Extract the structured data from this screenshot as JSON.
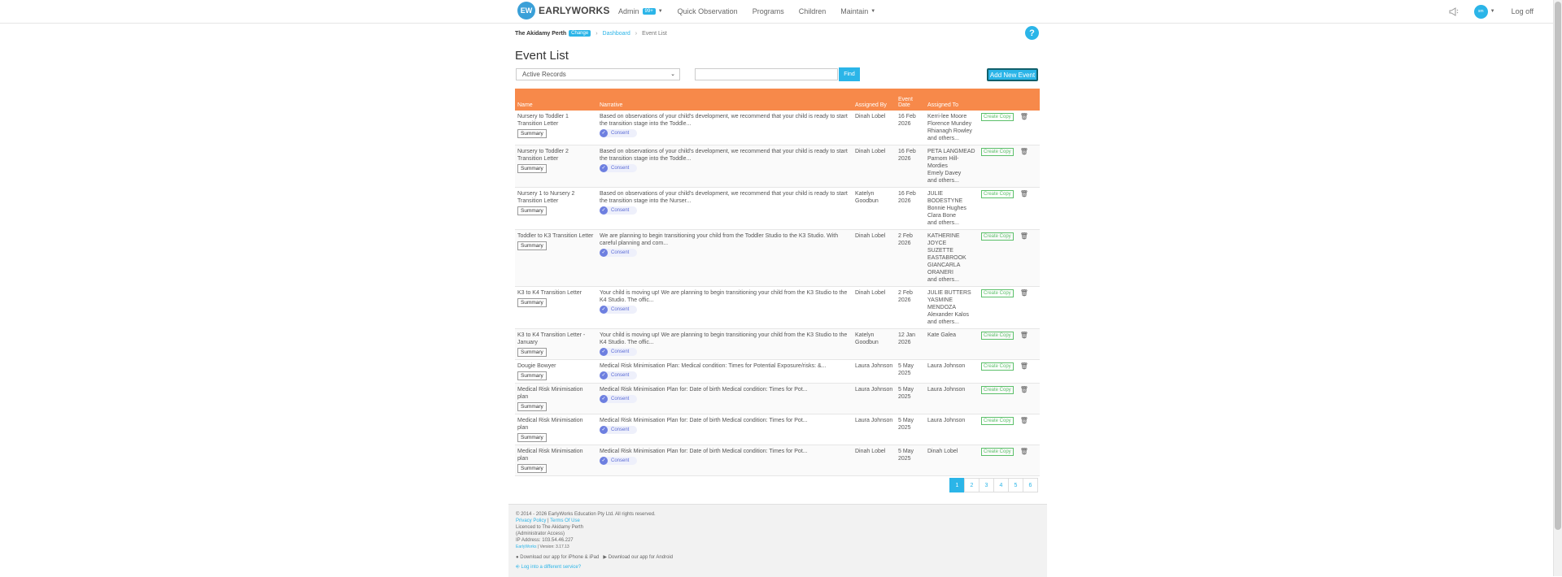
{
  "nav": {
    "logo_mark": "EW",
    "logo_text": "EARLYWORKS",
    "items": [
      {
        "label": "Admin",
        "badge": "99+",
        "dropdown": true
      },
      {
        "label": "Quick Observation"
      },
      {
        "label": "Programs"
      },
      {
        "label": "Children"
      },
      {
        "label": "Maintain",
        "dropdown": true
      }
    ],
    "avatar_initials": "sm",
    "logoff": "Log off"
  },
  "breadcrumb": {
    "site": "The Akidamy Perth",
    "change": "Change",
    "dashboard": "Dashboard",
    "current": "Event List"
  },
  "help": "?",
  "page_title": "Event List",
  "filter": {
    "selected": "Active Records"
  },
  "search": {
    "placeholder": ""
  },
  "find_label": "Find",
  "add_label": "Add New Event",
  "table": {
    "headers": {
      "name": "Name",
      "narrative": "Narrative",
      "assigned_by": "Assigned By",
      "event_date_1": "Event",
      "event_date_2": "Date",
      "assigned_to": "Assigned To"
    },
    "summary_label": "Summary",
    "consent_label": "Consent",
    "copy_label": "Create Copy",
    "rows": [
      {
        "name": "Nursery to Toddler 1 Transition Letter",
        "narrative": "Based on observations of your child's development, we recommend that your child is ready to start the transition stage into the Toddle...",
        "by": "Dinah Lobel",
        "date": "16 Feb 2026",
        "to": [
          "Kerri-lee Moore",
          "Florence Mundey",
          "Rhianagh Rowley",
          "and others..."
        ]
      },
      {
        "name": "Nursery to Toddler 2 Transition Letter",
        "narrative": "Based on observations of your child's development, we recommend that your child is ready to start the transition stage into the Toddle...",
        "by": "Dinah Lobel",
        "date": "16 Feb 2026",
        "to": [
          "PETA LANGMEAD",
          "Parnom Hill-",
          "Mordies",
          "Emely Davey",
          "and others..."
        ]
      },
      {
        "name": "Nursery 1 to Nursery 2 Transition Letter",
        "narrative": "Based on observations of your child's development, we recommend that your child is ready to start the transition stage into the Nurser...",
        "by": "Katelyn Goodbun",
        "date": "16 Feb 2026",
        "to": [
          "JULIE BODESTYNE",
          "Bonnie Hughes",
          "Clara Bone",
          "and others..."
        ]
      },
      {
        "name": "Toddler to K3 Transition Letter",
        "narrative": "We are planning to begin transitioning your child from the Toddler Studio to the K3 Studio. With careful planning and com...",
        "by": "Dinah Lobel",
        "date": "2 Feb 2026",
        "to": [
          "KATHERINE JOYCE",
          "SUZETTE",
          "EASTABROOK",
          "GIANCARLA",
          "ORANERI",
          "and others..."
        ]
      },
      {
        "name": "K3 to K4 Transition Letter",
        "narrative": "Your child is moving up! We are planning to begin transitioning your child from the K3 Studio to the K4 Studio. The offic...",
        "by": "Dinah Lobel",
        "date": "2 Feb 2026",
        "to": [
          "JULIE BUTTERS",
          "YASMINE",
          "MENDOZA",
          "Alexander Kalos",
          "and others..."
        ]
      },
      {
        "name": "K3 to K4 Transition Letter - January",
        "narrative": "Your child is moving up! We are planning to begin transitioning your child from the K3 Studio to the K4 Studio. The offic...",
        "by": "Katelyn Goodbun",
        "date": "12 Jan 2026",
        "to": [
          "Kate Galea"
        ]
      },
      {
        "name": "Dougie Bowyer",
        "narrative": "Medical Risk Minimisation Plan: Medical condition: Times for Potential Exposure/risks: &...",
        "by": "Laura Johnson",
        "date": "5 May 2025",
        "to": [
          "Laura Johnson"
        ]
      },
      {
        "name": "Medical Risk Minimisation plan",
        "narrative": "Medical Risk Minimisation Plan for: Date of birth Medical condition: Times for Pot...",
        "by": "Laura Johnson",
        "date": "5 May 2025",
        "to": [
          "Laura Johnson"
        ]
      },
      {
        "name": "Medical Risk Minimisation plan",
        "narrative": "Medical Risk Minimisation Plan for: Date of birth Medical condition: Times for Pot...",
        "by": "Laura Johnson",
        "date": "5 May 2025",
        "to": [
          "Laura Johnson"
        ]
      },
      {
        "name": "Medical Risk Minimisation plan",
        "narrative": "Medical Risk Minimisation Plan for: Date of birth Medical condition: Times for Pot...",
        "by": "Dinah Lobel",
        "date": "5 May 2025",
        "to": [
          "Dinah Lobel"
        ]
      }
    ]
  },
  "pagination": {
    "pages": [
      "1",
      "2",
      "3",
      "4",
      "5",
      "6"
    ],
    "active": "1"
  },
  "footer": {
    "copyright": "© 2014 - 2026 EarlyWorks Education Pty Ltd. All rights reserved.",
    "privacy": "Privacy Policy",
    "terms": "Terms Of Use",
    "licenced": "Licenced to The Akidamy Perth",
    "access": "(Administrator Access)",
    "ip": "IP Address: 103.54.46.227",
    "version_brand": "EarlyWorks",
    "version": "| Version: 3.17.13",
    "ios": "Download our app for iPhone & iPad",
    "android": "Download our app for Android",
    "login_other": "Log into a different service?"
  },
  "colors": {
    "accent": "#2bb5e8",
    "table_header": "#f7894a",
    "copy": "#5cc06a",
    "consent": "#6d7fe0"
  }
}
